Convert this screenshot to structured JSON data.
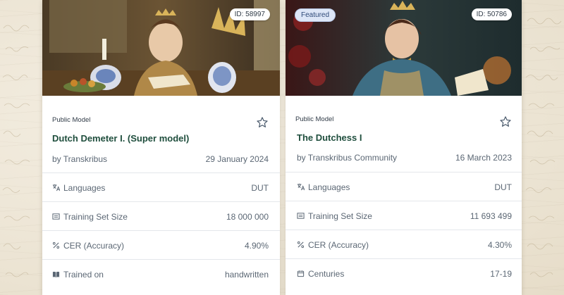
{
  "cards": [
    {
      "id_badge": "ID: 58997",
      "featured": "",
      "public_label": "Public Model",
      "title": "Dutch Demeter I. (Super model)",
      "by": "by Transkribus",
      "date": "29 January 2024",
      "rows": [
        {
          "icon": "translate-icon",
          "label": "Languages",
          "value": "DUT"
        },
        {
          "icon": "training-set-icon",
          "label": "Training Set Size",
          "value": "18 000 000"
        },
        {
          "icon": "percent-icon",
          "label": "CER (Accuracy)",
          "value": "4.90%"
        },
        {
          "icon": "book-icon",
          "label": "Trained on",
          "value": "handwritten"
        }
      ]
    },
    {
      "id_badge": "ID: 50786",
      "featured": "Featured",
      "public_label": "Public Model",
      "title": "The Dutchess I",
      "by": "by Transkribus Community",
      "date": "16 March 2023",
      "rows": [
        {
          "icon": "translate-icon",
          "label": "Languages",
          "value": "DUT"
        },
        {
          "icon": "training-set-icon",
          "label": "Training Set Size",
          "value": "11 693 499"
        },
        {
          "icon": "percent-icon",
          "label": "CER (Accuracy)",
          "value": "4.30%"
        },
        {
          "icon": "calendar-icon",
          "label": "Centuries",
          "value": "17-19"
        }
      ]
    }
  ],
  "colors": {
    "title_green": "#1f4e3d",
    "text_gray": "#5b6774",
    "featured_bg": "#dde6f7",
    "page_bg": "#efe8da"
  }
}
